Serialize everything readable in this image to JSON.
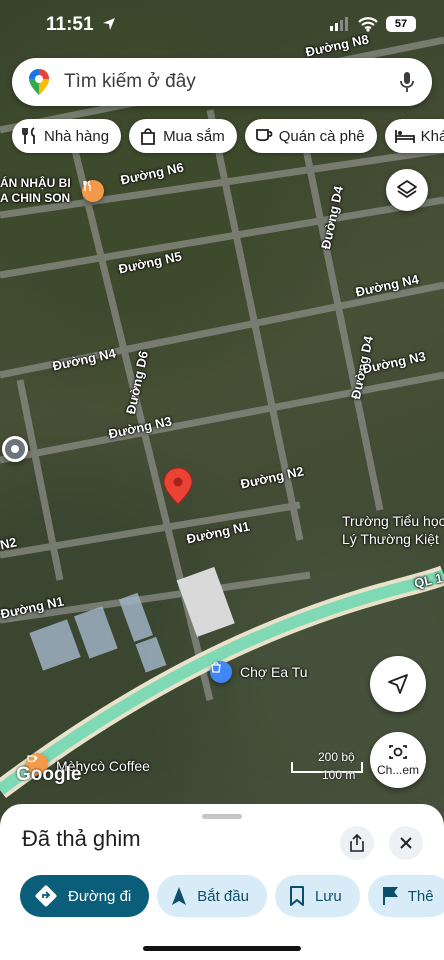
{
  "status_bar": {
    "time": "11:51",
    "battery": "57"
  },
  "search": {
    "placeholder": "Tìm kiếm ở đây"
  },
  "chips": [
    {
      "label": "Nhà hàng",
      "icon": "restaurant-icon"
    },
    {
      "label": "Mua sắm",
      "icon": "shopping-bag-icon"
    },
    {
      "label": "Quán cà phê",
      "icon": "coffee-icon"
    },
    {
      "label": "Khá",
      "icon": "hotel-bed-icon"
    }
  ],
  "map": {
    "street_labels": [
      "Đường N8",
      "Đường N6",
      "Đường D4",
      "Đường N5",
      "Đường N4",
      "Đường D6",
      "Đường D4",
      "Đường N4",
      "Đường N3",
      "Đường N3",
      "Đường N2",
      "Đường N1",
      "N2",
      "Đường N1",
      "QL 1"
    ],
    "poi_restaurant": "ÁN NHẬU BI\nA CHIN SON",
    "poi_school": "Trường Tiểu học\nLý Thường Kiệt",
    "poi_market": "Chợ Ea Tu",
    "poi_cafe": "Mèhycò Coffee",
    "scale_top": "200 bộ",
    "scale_bottom": "100 m",
    "google_logo": "Google",
    "fab_label": "Ch...em",
    "accent_route": "#7fd9b5",
    "pin_color": "#ea4335"
  },
  "sheet": {
    "title": "Đã thả ghim",
    "actions": [
      {
        "label": "Đường đi",
        "icon": "directions-icon"
      },
      {
        "label": "Bắt đầu",
        "icon": "navigation-arrow-icon"
      },
      {
        "label": "Lưu",
        "icon": "bookmark-icon"
      },
      {
        "label": "Thê",
        "icon": "flag-icon"
      }
    ]
  }
}
